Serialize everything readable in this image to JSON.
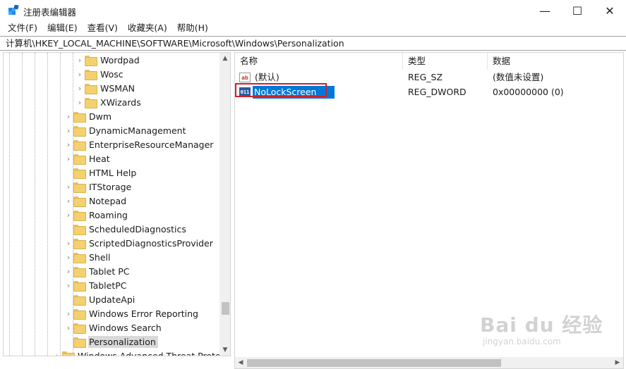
{
  "window": {
    "title": "注册表编辑器",
    "minimize_glyph": "—",
    "maximize_glyph": "☐",
    "close_glyph": "✕"
  },
  "menu": [
    {
      "label": "文件(F)"
    },
    {
      "label": "编辑(E)"
    },
    {
      "label": "查看(V)"
    },
    {
      "label": "收藏夹(A)"
    },
    {
      "label": "帮助(H)"
    }
  ],
  "address": {
    "path": "计算机\\HKEY_LOCAL_MACHINE\\SOFTWARE\\Microsoft\\Windows\\Personalization"
  },
  "tree": {
    "items": [
      {
        "label": "Wordpad",
        "expandable": true
      },
      {
        "label": "Wosc",
        "expandable": true
      },
      {
        "label": "WSMAN",
        "expandable": true
      },
      {
        "label": "XWizards",
        "expandable": true
      },
      {
        "label": "Dwm",
        "expandable": true
      },
      {
        "label": "DynamicManagement",
        "expandable": true
      },
      {
        "label": "EnterpriseResourceManager",
        "expandable": true
      },
      {
        "label": "Heat",
        "expandable": true
      },
      {
        "label": "HTML Help",
        "expandable": false
      },
      {
        "label": "ITStorage",
        "expandable": true
      },
      {
        "label": "Notepad",
        "expandable": true
      },
      {
        "label": "Roaming",
        "expandable": true
      },
      {
        "label": "ScheduledDiagnostics",
        "expandable": false
      },
      {
        "label": "ScriptedDiagnosticsProvider",
        "expandable": true
      },
      {
        "label": "Shell",
        "expandable": true
      },
      {
        "label": "Tablet PC",
        "expandable": true
      },
      {
        "label": "TabletPC",
        "expandable": true
      },
      {
        "label": "UpdateApi",
        "expandable": false
      },
      {
        "label": "Windows Error Reporting",
        "expandable": true
      },
      {
        "label": "Windows Search",
        "expandable": true
      },
      {
        "label": "Personalization",
        "expandable": false,
        "selected": true
      },
      {
        "label": "Windows Advanced Threat Protect",
        "expandable": true
      }
    ]
  },
  "list": {
    "columns": {
      "name": "名称",
      "type": "类型",
      "data": "数据"
    },
    "rows": [
      {
        "icon": "string-value-icon",
        "icon_text": "ab",
        "name": "(默认)",
        "type": "REG_SZ",
        "data": "(数值未设置)"
      },
      {
        "icon": "dword-value-icon",
        "icon_text": "011",
        "name": "NoLockScreen",
        "type": "REG_DWORD",
        "data": "0x00000000 (0)",
        "renaming": true
      }
    ]
  },
  "watermark": {
    "logo": "Bai du 经验",
    "url": "jingyan.baidu.com"
  },
  "colors": {
    "selection_blue": "#0078d7",
    "highlight_red": "#d0212e",
    "folder_yellow": "#f3d16f"
  }
}
